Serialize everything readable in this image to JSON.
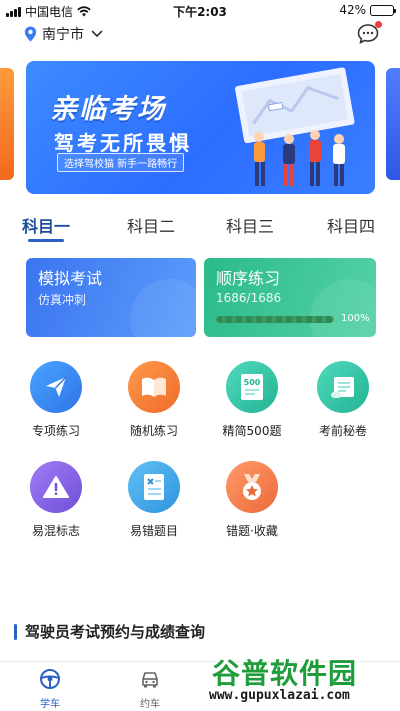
{
  "status_bar": {
    "carrier": "中国电信",
    "time": "下午2:03",
    "battery": "42%",
    "battery_level": 0.42
  },
  "header": {
    "city": "南宁市",
    "icons": {
      "location": "location-pin-icon",
      "dropdown": "chevron-down-icon",
      "messages": "chat-bubble-icon"
    }
  },
  "banner": {
    "title": "亲临考场",
    "subtitle": "驾考无所畏惧",
    "tagline": "选择驾校猫 新手一路畅行"
  },
  "tabs": [
    {
      "label": "科目一",
      "active": true
    },
    {
      "label": "科目二",
      "active": false
    },
    {
      "label": "科目三",
      "active": false
    },
    {
      "label": "科目四",
      "active": false
    }
  ],
  "cards": {
    "exam": {
      "title": "模拟考试",
      "subtitle": "仿真冲刺",
      "color": "#3b75f0"
    },
    "order": {
      "title": "顺序练习",
      "progress_text": "1686/1686",
      "progress_percent": "100%",
      "progress": 1.0,
      "color": "#2bba8a"
    }
  },
  "tools": [
    {
      "label": "专项练习",
      "icon": "paper-plane-icon",
      "color": "#3a8ef0"
    },
    {
      "label": "随机练习",
      "icon": "open-book-icon",
      "color": "#f27a3a"
    },
    {
      "label": "精简500题",
      "icon": "document-500-icon",
      "color": "#2fc2a5"
    },
    {
      "label": "考前秘卷",
      "icon": "scroll-icon",
      "color": "#2fc2a5"
    },
    {
      "label": "易混标志",
      "icon": "warning-triangle-icon",
      "color": "#8a63e6"
    },
    {
      "label": "易错题目",
      "icon": "error-list-icon",
      "color": "#3aa3e8"
    },
    {
      "label": "错题·收藏",
      "icon": "star-badge-icon",
      "color": "#f07a4a"
    }
  ],
  "section": {
    "title": "驾驶员考试预约与成绩查询"
  },
  "bottom_nav": [
    {
      "label": "学车",
      "icon": "steering-wheel-icon",
      "active": true
    },
    {
      "label": "约车",
      "icon": "car-icon",
      "active": false
    }
  ],
  "watermark": {
    "title": "谷普软件园",
    "url": "www.gupuxlazai.com"
  },
  "colors": {
    "accent": "#2a60c4",
    "tab_active": "#1d4f9c",
    "badge": "#f03c3c"
  }
}
